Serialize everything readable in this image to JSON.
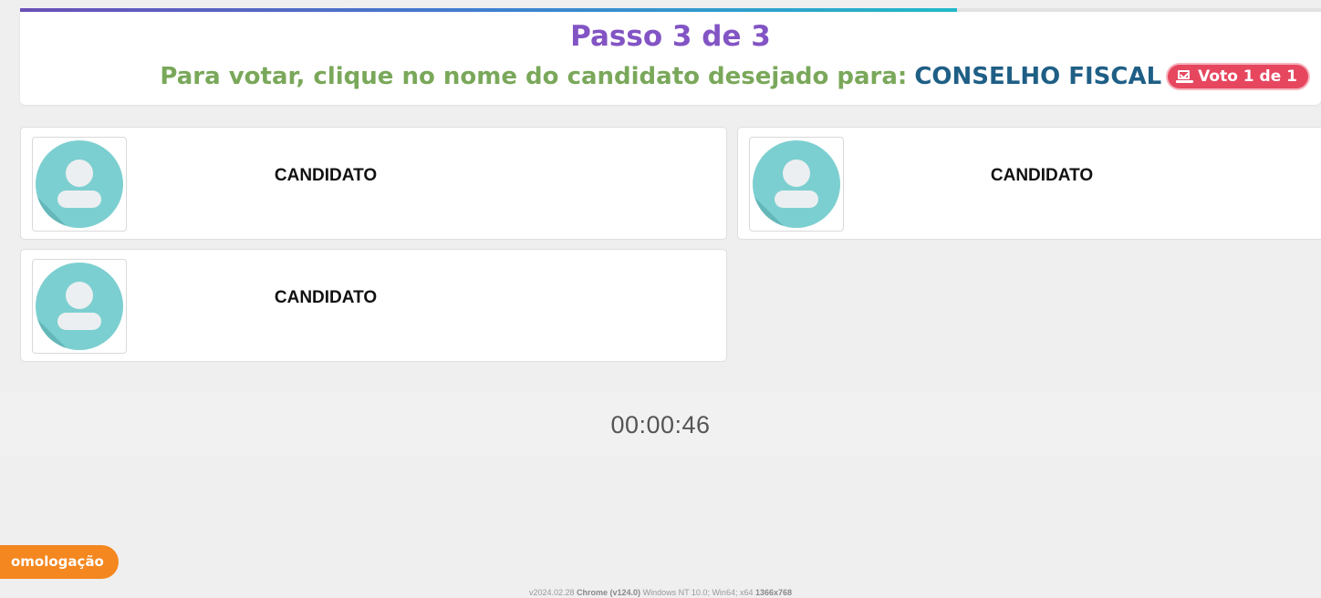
{
  "progress": {
    "fraction": 0.72
  },
  "header": {
    "step_title": "Passo 3 de 3",
    "instruction": "Para votar, clique no nome do candidato desejado para:",
    "position_name": "CONSELHO FISCAL",
    "vote_badge": "Voto 1 de 1"
  },
  "candidates": [
    {
      "name": "CANDIDATO",
      "avatar": "user-avatar-icon"
    },
    {
      "name": "CANDIDATO",
      "avatar": "user-avatar-icon"
    },
    {
      "name": "CANDIDATO",
      "avatar": "user-avatar-icon"
    }
  ],
  "timer": "00:00:46",
  "environment_badge": "omologação",
  "footer": {
    "version": "v2024.02.28",
    "browser": "Chrome (v124.0)",
    "os": "Windows NT 10.0; Win64; x64",
    "resolution": "1366x768"
  },
  "colors": {
    "step_title": "#8254c4",
    "instruction": "#7aa85a",
    "position_name": "#1f5f86",
    "vote_badge": "#e6475f",
    "avatar": "#7ccfd0",
    "environment_badge": "#f4871f"
  }
}
